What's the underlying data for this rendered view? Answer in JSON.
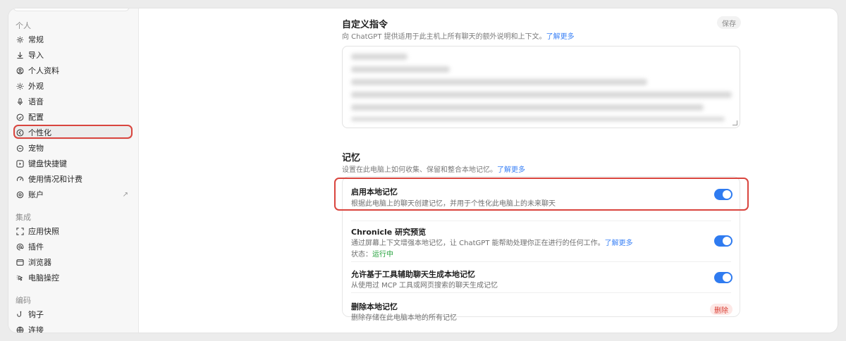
{
  "sidebar": {
    "sections": [
      {
        "label": "个人",
        "items": [
          {
            "label": "常规",
            "icon": "gear-icon"
          },
          {
            "label": "导入",
            "icon": "download-icon"
          },
          {
            "label": "个人资料",
            "icon": "profile-icon"
          },
          {
            "label": "外观",
            "icon": "sun-icon"
          },
          {
            "label": "语音",
            "icon": "microphone-icon"
          },
          {
            "label": "配置",
            "icon": "config-icon"
          },
          {
            "label": "个性化",
            "icon": "personalization-icon",
            "active": true
          },
          {
            "label": "宠物",
            "icon": "pet-icon"
          },
          {
            "label": "键盘快捷键",
            "icon": "keyboard-icon"
          },
          {
            "label": "使用情况和计费",
            "icon": "gauge-icon"
          },
          {
            "label": "账户",
            "icon": "account-icon",
            "external_icon": "arrow-up-right-icon"
          }
        ]
      },
      {
        "label": "集成",
        "items": [
          {
            "label": "应用快照",
            "icon": "snapshot-icon"
          },
          {
            "label": "插件",
            "icon": "at-icon"
          },
          {
            "label": "浏览器",
            "icon": "browser-icon"
          },
          {
            "label": "电脑操控",
            "icon": "computer-control-icon"
          }
        ]
      },
      {
        "label": "编码",
        "items": [
          {
            "label": "钩子",
            "icon": "hook-icon"
          },
          {
            "label": "连接",
            "icon": "globe-icon"
          }
        ]
      }
    ]
  },
  "custom_instructions": {
    "title": "自定义指令",
    "description": "向 ChatGPT 提供适用于此主机上所有聊天的额外说明和上下文。",
    "learn_more": "了解更多",
    "save_label": "保存"
  },
  "memory": {
    "title": "记忆",
    "description": "设置在此电脑上如何收集、保留和整合本地记忆。",
    "learn_more": "了解更多",
    "rows": [
      {
        "title": "启用本地记忆",
        "subtitle": "根据此电脑上的聊天创建记忆，并用于个性化此电脑上的未来聊天",
        "toggle_on": true
      },
      {
        "title": "Chronicle 研究预览",
        "subtitle": "通过屏幕上下文增强本地记忆，让 ChatGPT 能帮助处理你正在进行的任何工作。",
        "learn_more": "了解更多",
        "status_label": "状态：",
        "status_value": "运行中",
        "toggle_on": true
      },
      {
        "title": "允许基于工具辅助聊天生成本地记忆",
        "subtitle": "从使用过 MCP 工具或网页搜索的聊天生成记忆",
        "toggle_on": true
      },
      {
        "title": "删除本地记忆",
        "subtitle": "删除存储在此电脑本地的所有记忆",
        "delete_label": "删除"
      }
    ]
  },
  "colors": {
    "accent": "#2f7bf0",
    "highlight": "#d9453e",
    "status_ok": "#22a13a",
    "danger": "#d93a2f"
  }
}
